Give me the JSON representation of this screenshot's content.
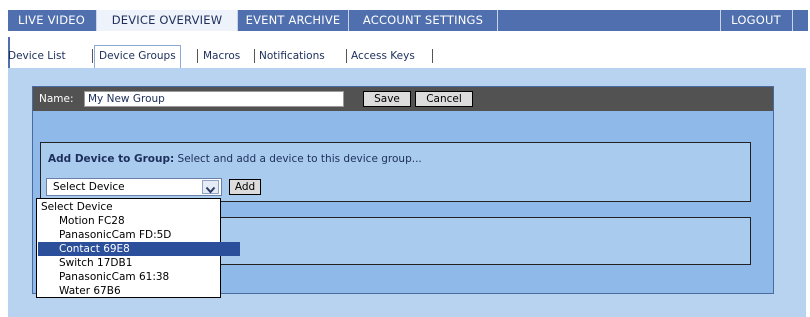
{
  "nav": {
    "tabs": [
      {
        "label": "LIVE VIDEO"
      },
      {
        "label": "DEVICE OVERVIEW"
      },
      {
        "label": "EVENT ARCHIVE"
      },
      {
        "label": "ACCOUNT SETTINGS"
      }
    ],
    "logout": "LOGOUT"
  },
  "subnav": {
    "tabs": [
      {
        "label": "Device List"
      },
      {
        "label": "Device Groups"
      },
      {
        "label": "Macros"
      },
      {
        "label": "Notifications"
      },
      {
        "label": "Access Keys"
      }
    ]
  },
  "group": {
    "name_label": "Name:",
    "name_value": "My New Group",
    "save_label": "Save",
    "cancel_label": "Cancel"
  },
  "add_device": {
    "title_bold": "Add Device to Group:",
    "title_rest": " Select and add a device to this device group...",
    "select_value": "Select Device",
    "add_label": "Add",
    "options": [
      "Select Device",
      "Motion FC28",
      "PanasonicCam FD:5D",
      "Contact 69E8",
      "Switch 17DB1",
      "PanasonicCam 61:38",
      "Water 67B6"
    ],
    "highlighted_option": "Contact 69E8"
  },
  "colors": {
    "nav_bg": "#4f6fae",
    "content_bg": "#b8d3ef",
    "panel_bg": "#8eb9e9",
    "highlight": "#2b4f9a"
  }
}
